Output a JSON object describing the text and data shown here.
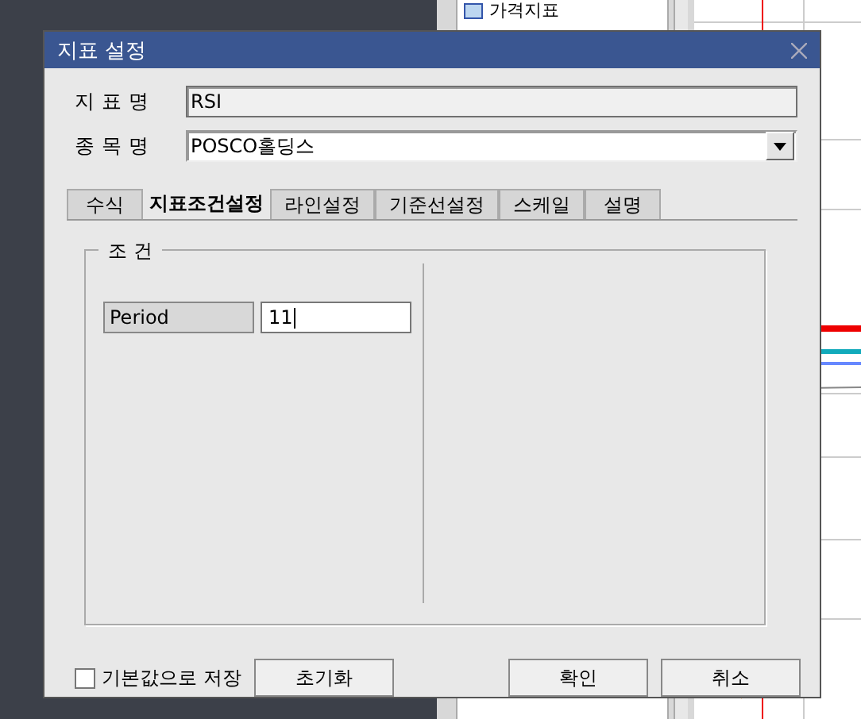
{
  "background": {
    "tree_items": [
      {
        "label": "가격지표"
      }
    ]
  },
  "dialog": {
    "title": "지표 설정",
    "fields": [
      {
        "label": "지 표 명",
        "value": "RSI",
        "kind": "readonly"
      },
      {
        "label": "종 목 명",
        "value": "POSCO홀딩스",
        "kind": "combo"
      }
    ],
    "tabs": [
      {
        "label": "수식",
        "selected": false
      },
      {
        "label": "지표조건설정",
        "selected": true
      },
      {
        "label": "라인설정",
        "selected": false
      },
      {
        "label": "기준선설정",
        "selected": false
      },
      {
        "label": "스케일",
        "selected": false
      },
      {
        "label": "설명",
        "selected": false
      }
    ],
    "group": {
      "title": "조 건",
      "params": [
        {
          "label": "Period",
          "value": "11",
          "focused": true
        }
      ]
    },
    "save_default": {
      "label": "기본값으로 저장",
      "checked": false
    },
    "buttons": [
      {
        "label": "초기화"
      },
      {
        "label": "확인"
      },
      {
        "label": "취소"
      }
    ]
  }
}
